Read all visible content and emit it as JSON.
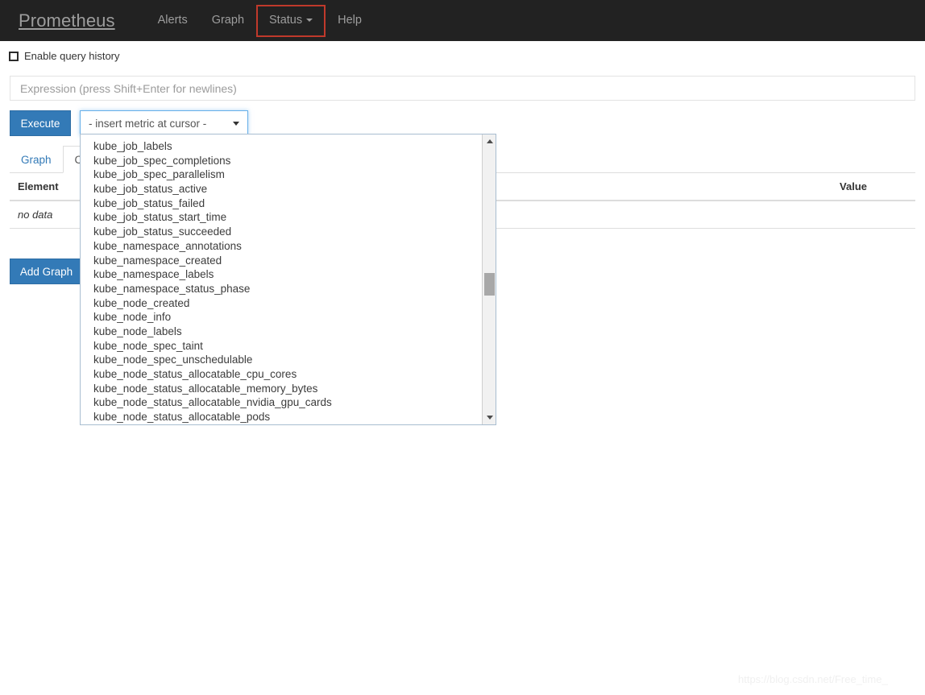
{
  "navbar": {
    "brand": "Prometheus",
    "background_color": "#222222",
    "link_color": "#9d9d9d",
    "items": [
      {
        "label": "Alerts",
        "name": "alerts"
      },
      {
        "label": "Graph",
        "name": "graph"
      },
      {
        "label": "Status",
        "name": "status",
        "has_caret": true,
        "highlight_color": "#c0392b"
      },
      {
        "label": "Help",
        "name": "help"
      }
    ]
  },
  "query_history": {
    "label": "Enable query history",
    "checked": false
  },
  "expression": {
    "value": "",
    "placeholder": "Expression (press Shift+Enter for newlines)"
  },
  "buttons": {
    "execute": "Execute",
    "add_graph": "Add Graph",
    "primary_color": "#337ab7"
  },
  "metric_select": {
    "selected_label": "- insert metric at cursor -",
    "expanded": true,
    "focus_color": "#66afe9",
    "options": [
      "kube_job_labels",
      "kube_job_spec_completions",
      "kube_job_spec_parallelism",
      "kube_job_status_active",
      "kube_job_status_failed",
      "kube_job_status_start_time",
      "kube_job_status_succeeded",
      "kube_namespace_annotations",
      "kube_namespace_created",
      "kube_namespace_labels",
      "kube_namespace_status_phase",
      "kube_node_created",
      "kube_node_info",
      "kube_node_labels",
      "kube_node_spec_taint",
      "kube_node_spec_unschedulable",
      "kube_node_status_allocatable_cpu_cores",
      "kube_node_status_allocatable_memory_bytes",
      "kube_node_status_allocatable_nvidia_gpu_cards",
      "kube_node_status_allocatable_pods"
    ]
  },
  "tabs": [
    {
      "label": "Graph",
      "name": "graph",
      "active": false
    },
    {
      "label": "Console",
      "name": "console",
      "active": true
    }
  ],
  "result_table": {
    "columns": [
      "Element",
      "Value"
    ],
    "rows": [
      {
        "element": "no data",
        "value": ""
      }
    ]
  },
  "watermark": "https://blog.csdn.net/Free_time_"
}
